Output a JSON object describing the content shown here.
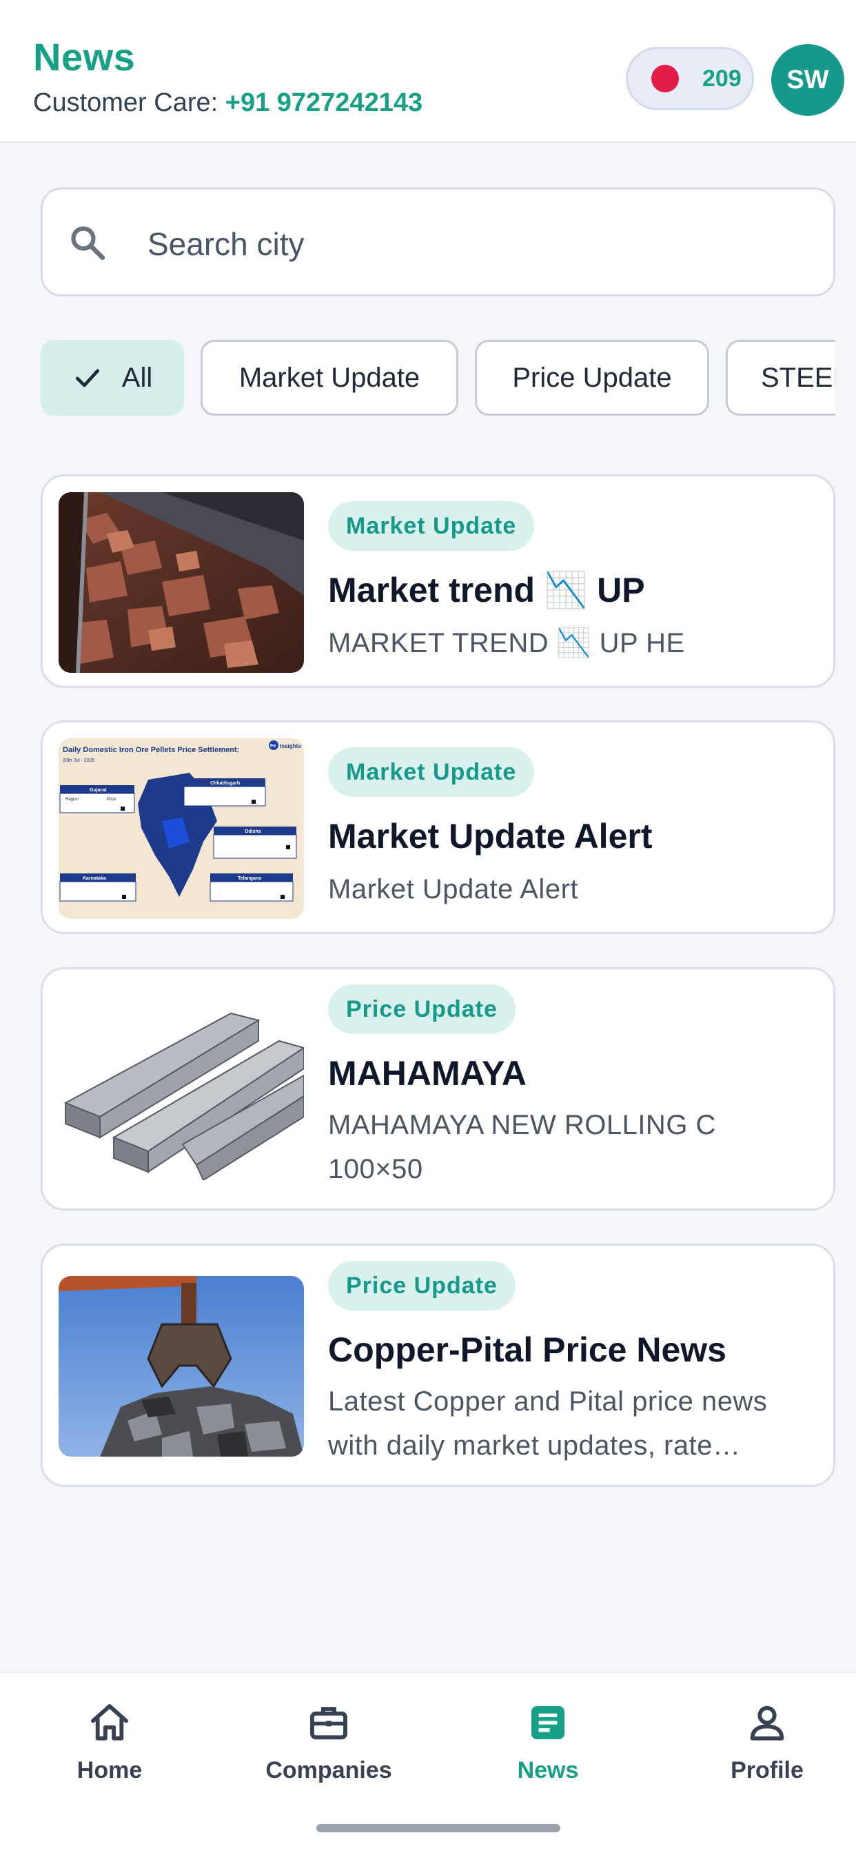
{
  "header": {
    "title": "News",
    "care_label": "Customer Care: ",
    "care_phone": "+91 9727242143",
    "points": "209",
    "avatar_initials": "SW"
  },
  "search": {
    "placeholder": "Search city"
  },
  "filters": {
    "chips": [
      "All",
      "Market Update",
      "Price Update",
      "STEEL"
    ],
    "selected": "All"
  },
  "news": [
    {
      "category": "Market Update",
      "title": "Market trend 📉 UP",
      "description": "MARKET TREND 📉 UP HE",
      "image": "iron-ore-conveyor"
    },
    {
      "category": "Market Update",
      "title": "Market Update Alert",
      "description": "Market Update Alert",
      "image": "iron-ore-pellets-price-map",
      "image_texts": {
        "heading": "Daily Domestic Iron Ore Pellets Price Settlement:",
        "brand": "Fe",
        "brand_suffix": "Insights",
        "date": "20th Jul - 2026",
        "gujarat": "Gujarat",
        "chhattisgarh": "Chhattisgarh",
        "odisha": "Odisha",
        "karnataka": "Karnataka",
        "telangana": "Telangana",
        "region": "Region",
        "price": "Price"
      }
    },
    {
      "category": "Price Update",
      "title": "MAHAMAYA",
      "description": "MAHAMAYA NEW ROLLING C 100×50",
      "image": "steel-channels"
    },
    {
      "category": "Price Update",
      "title": "Copper-Pital Price News",
      "description": "Latest Copper and Pital price news with daily market updates, rate changes and trends.",
      "image": "scrap-metal-grab"
    }
  ],
  "bottom_nav": {
    "items": [
      {
        "label": "Home",
        "icon": "home-icon"
      },
      {
        "label": "Companies",
        "icon": "briefcase-icon"
      },
      {
        "label": "News",
        "icon": "news-icon"
      },
      {
        "label": "Profile",
        "icon": "person-icon"
      }
    ],
    "active": "News"
  },
  "colors": {
    "brand": "#16a085",
    "badge_bg": "#d9f1ed",
    "alert_dot": "#e11d48"
  }
}
